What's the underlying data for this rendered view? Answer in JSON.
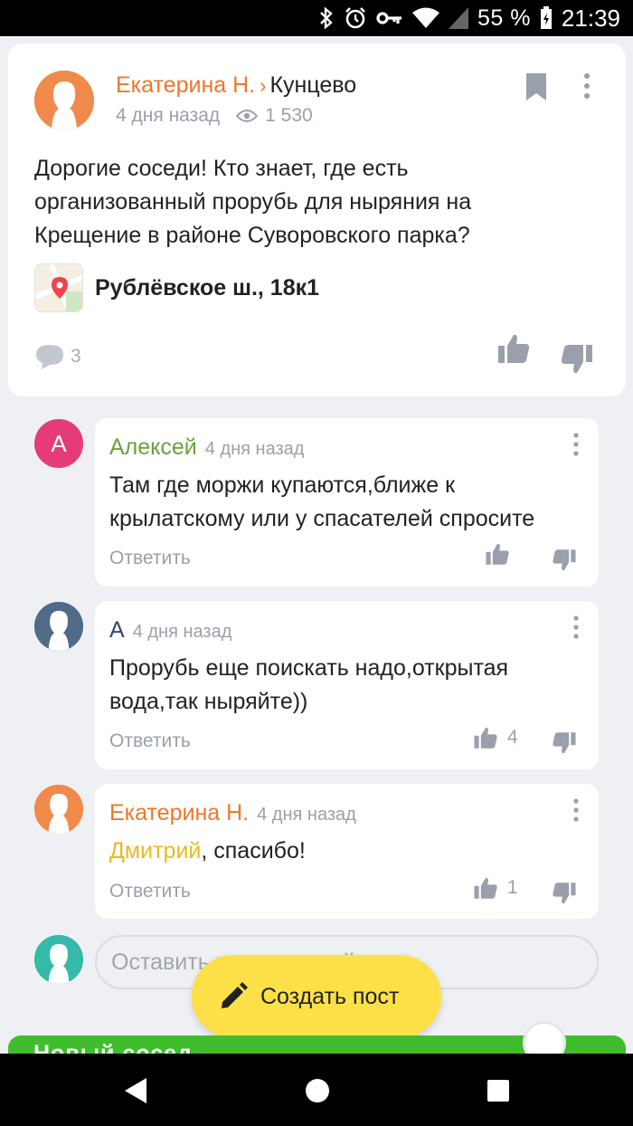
{
  "status_bar": {
    "battery_pct": "55 %",
    "time": "21:39",
    "icons": [
      "bluetooth-icon",
      "alarm-icon",
      "vpn-key-icon",
      "wifi-icon",
      "cell-signal-icon",
      "battery-icon"
    ]
  },
  "post": {
    "author": "Екатерина Н.",
    "chevron": "›",
    "place": "Кунцево",
    "time": "4 дня назад",
    "views": "1 530",
    "text": "Дорогие соседи! Кто знает, где есть организованный прорубь для ныряния на Крещение в районе Суворовского парка?",
    "address": "Рублёвское ш., 18к1",
    "comments_count": "3"
  },
  "comments": [
    {
      "avatar_letter": "А",
      "name": "Алексей",
      "name_color": "#6aa23a",
      "time": "4 дня назад",
      "text": "Там где моржи купаются,ближе к крылатскому или у спасателей спросите",
      "reply": "Ответить",
      "likes": ""
    },
    {
      "name": "А",
      "name_color": "#2f4a6e",
      "time": "4 дня назад",
      "text": "Прорубь еще поискать надо,открытая вода,так ныряйте))",
      "reply": "Ответить",
      "likes": "4"
    },
    {
      "name": "Екатерина Н.",
      "name_color": "#f07628",
      "time": "4 дня назад",
      "mention": "Дмитрий",
      "mention_color": "#e8b923",
      "text_rest": ", спасибо!",
      "reply": "Ответить",
      "likes": "1"
    }
  ],
  "comment_input": {
    "placeholder": "Оставить комментарий"
  },
  "fab": {
    "label": "Создать пост"
  },
  "banner": {
    "text": "Новый сосед"
  },
  "colors": {
    "accent_orange": "#f07628",
    "fab_yellow": "#fde047",
    "banner_green": "#3fbd2c",
    "background": "#eff0f3"
  }
}
